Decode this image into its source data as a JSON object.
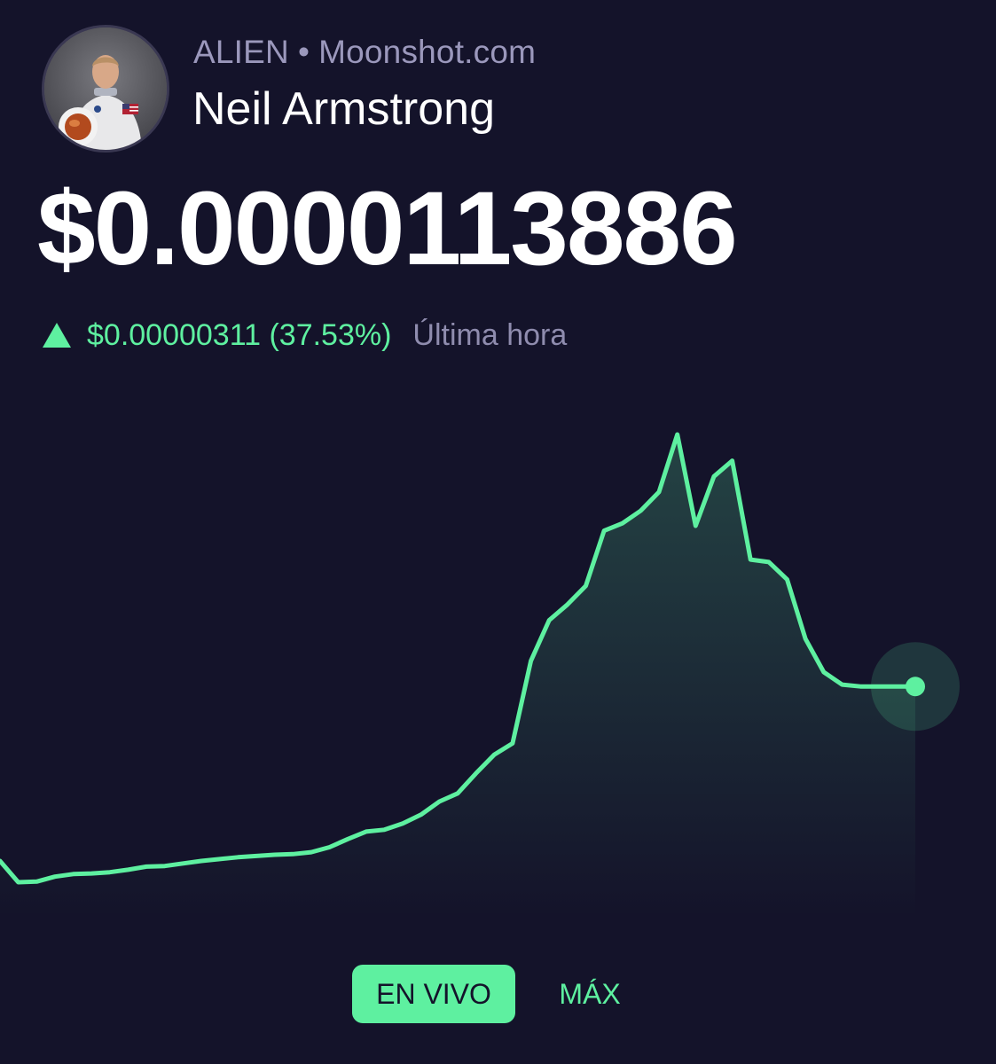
{
  "header": {
    "ticker": "ALIEN",
    "separator": "•",
    "site": "Moonshot.com",
    "name": "Neil Armstrong",
    "avatar_icon": "astronaut-portrait"
  },
  "price": {
    "current": "$0.0000113886",
    "change_icon": "triangle-up-icon",
    "change_value": "$0.00000311 (37.53%)",
    "change_period": "Última hora"
  },
  "colors": {
    "background": "#14132a",
    "accent": "#5ef0a0",
    "muted_text": "#9b98bc"
  },
  "chart_data": {
    "type": "line",
    "title": "",
    "xlabel": "",
    "ylabel": "",
    "grid": false,
    "x": [
      0,
      2,
      4,
      6,
      8,
      10,
      12,
      14,
      16,
      18,
      20,
      22,
      24,
      26,
      28,
      30,
      32,
      34,
      36,
      38,
      40,
      42,
      44,
      46,
      48,
      50,
      52,
      54,
      56,
      58,
      60,
      62,
      64,
      66,
      68,
      70,
      72,
      74,
      76,
      78,
      80,
      82,
      84,
      86,
      88,
      90,
      92,
      94,
      96,
      98,
      100
    ],
    "values": [
      8.6,
      8.26,
      8.27,
      8.35,
      8.39,
      8.4,
      8.42,
      8.46,
      8.51,
      8.52,
      8.56,
      8.6,
      8.63,
      8.66,
      8.68,
      8.7,
      8.71,
      8.74,
      8.82,
      8.95,
      9.07,
      9.1,
      9.2,
      9.34,
      9.55,
      9.68,
      10.0,
      10.3,
      10.48,
      11.8,
      12.45,
      12.7,
      13.0,
      13.88,
      14.0,
      14.2,
      14.5,
      15.42,
      13.96,
      14.75,
      15.0,
      13.42,
      13.38,
      13.1,
      12.15,
      11.62,
      11.42,
      11.39,
      11.39,
      11.39,
      11.39
    ],
    "last_point_highlighted": true,
    "timeframes": [
      "EN VIVO",
      "MÁX"
    ],
    "selected_timeframe": "EN VIVO"
  }
}
